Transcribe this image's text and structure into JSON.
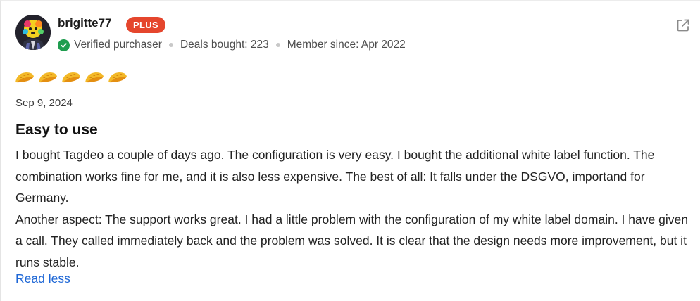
{
  "reviewer": {
    "username": "brigitte77",
    "badge": "PLUS",
    "verified_label": "Verified purchaser",
    "deals_bought": "Deals bought: 223",
    "member_since": "Member since: Apr 2022",
    "avatar": "avatar-image",
    "verified_icon": "check-circle-icon"
  },
  "actions": {
    "open_icon": "external-link-icon",
    "read_less_label": "Read less"
  },
  "review": {
    "rating": 5,
    "rating_max": 5,
    "rating_icon": "taco-icon",
    "date": "Sep 9, 2024",
    "title": "Easy to use",
    "paragraphs": [
      "I bought Tagdeo a couple of days ago. The configuration is very easy. I bought the additional white label function. The combination works fine for me, and it is also less expensive. The best of all: It falls under the DSGVO, importand for Germany.",
      "Another aspect: The support works great. I had a little problem with the configuration of my white label domain. I have given a call. They called immediately back and the problem was solved. It is clear that the design needs more improvement, but it runs stable."
    ]
  },
  "colors": {
    "badge": "#e5462d",
    "verified": "#1f9d4f",
    "link": "#1e67d6",
    "taco": "#f3b928"
  }
}
